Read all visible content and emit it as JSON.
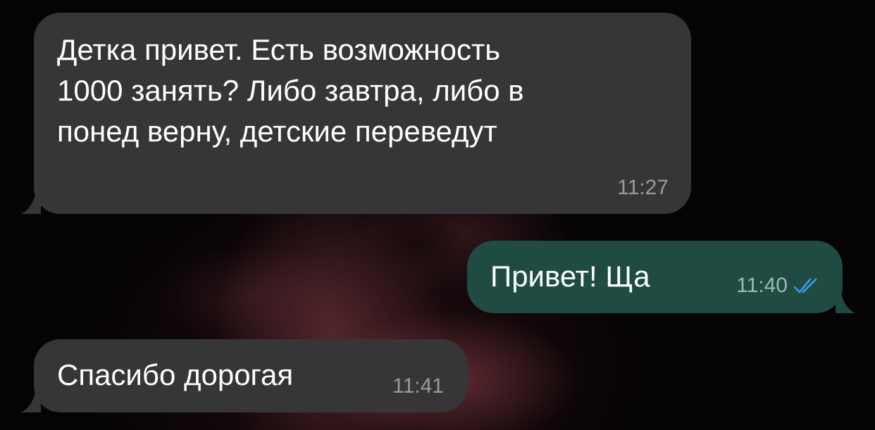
{
  "chat": {
    "messages": [
      {
        "direction": "incoming",
        "lines": [
          "Детка привет. Есть возможность",
          "1000 занять? Либо завтра, либо в",
          "понед верну, детские переведут"
        ],
        "time": "11:27"
      },
      {
        "direction": "outgoing",
        "text": "Привет! Ща",
        "time": "11:40",
        "status_icon": "double-check-read-icon"
      },
      {
        "direction": "incoming",
        "text": "Спасибо дорогая",
        "time": "11:41"
      }
    ]
  },
  "colors": {
    "incoming_bubble": "#363638",
    "outgoing_bubble": "#1f4b42",
    "read_receipt": "#3a9bf0",
    "timestamp": "#9a9a9e"
  }
}
